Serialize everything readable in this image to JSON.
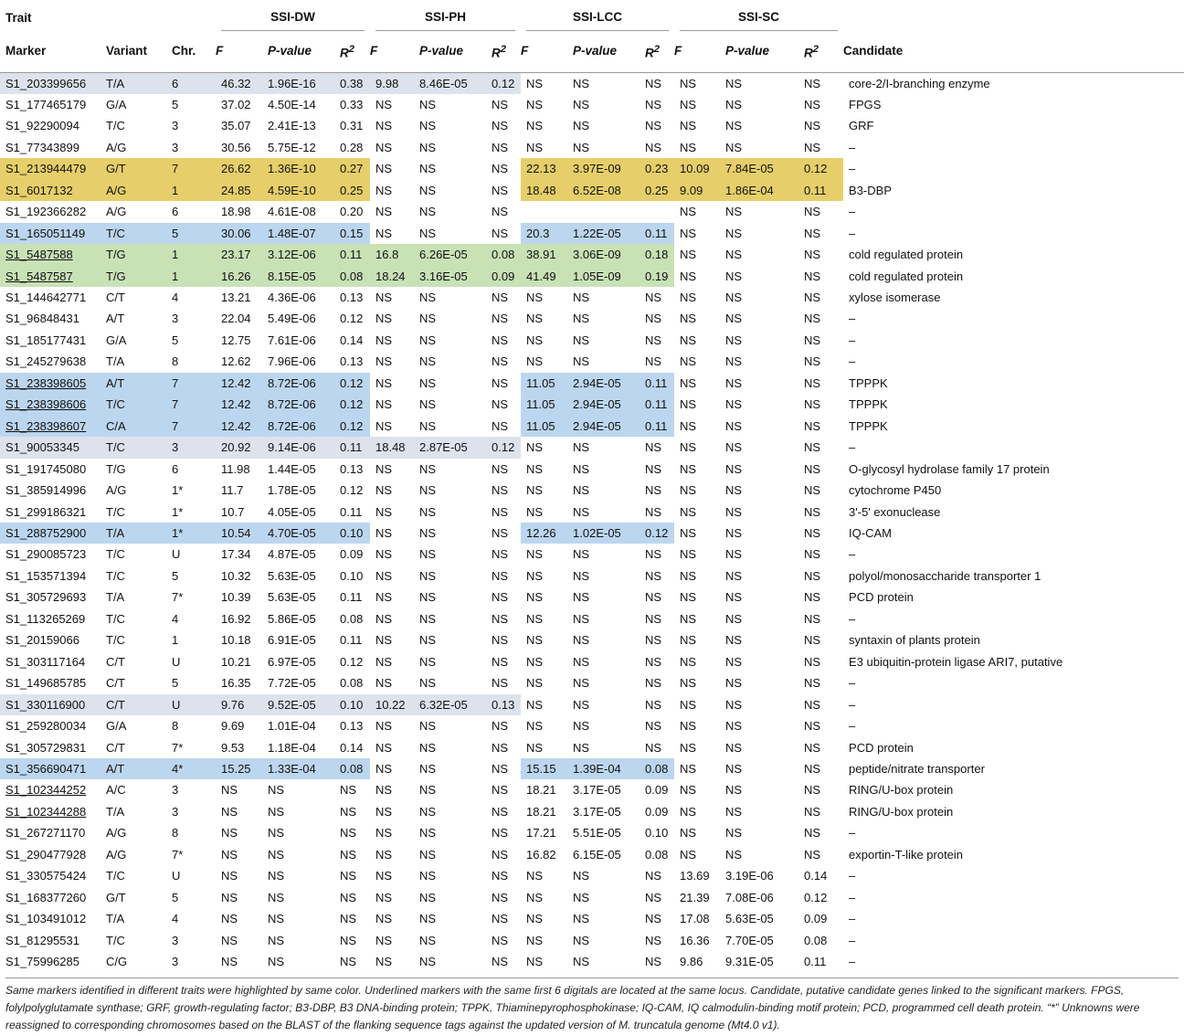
{
  "header": {
    "trait": "Trait",
    "groups": [
      "SSI-DW",
      "SSI-PH",
      "SSI-LCC",
      "SSI-SC"
    ],
    "marker": "Marker",
    "variant": "Variant",
    "chr": "Chr.",
    "f": "F",
    "p": "P-value",
    "r_base": "R",
    "r_sup": "2",
    "candidate": "Candidate"
  },
  "colors": {
    "gray": "#dde3ec",
    "yellow": "#e6cf6a",
    "blue": "#bcd6ef",
    "green": "#c8e2b6"
  },
  "rows": [
    {
      "m": "S1_203399656",
      "v": "T/A",
      "c": "6",
      "dw": [
        "46.32",
        "1.96E-16",
        "0.38"
      ],
      "ph": [
        "9.98",
        "8.46E-05",
        "0.12"
      ],
      "lcc": [
        "NS",
        "NS",
        "NS"
      ],
      "sc": [
        "NS",
        "NS",
        "NS"
      ],
      "cand": "core-2/I-branching enzyme",
      "hl": "gray",
      "hg": [
        "dw",
        "ph"
      ]
    },
    {
      "m": "S1_177465179",
      "v": "G/A",
      "c": "5",
      "dw": [
        "37.02",
        "4.50E-14",
        "0.33"
      ],
      "ph": [
        "NS",
        "NS",
        "NS"
      ],
      "lcc": [
        "NS",
        "NS",
        "NS"
      ],
      "sc": [
        "NS",
        "NS",
        "NS"
      ],
      "cand": "FPGS"
    },
    {
      "m": "S1_92290094",
      "v": "T/C",
      "c": "3",
      "dw": [
        "35.07",
        "2.41E-13",
        "0.31"
      ],
      "ph": [
        "NS",
        "NS",
        "NS"
      ],
      "lcc": [
        "NS",
        "NS",
        "NS"
      ],
      "sc": [
        "NS",
        "NS",
        "NS"
      ],
      "cand": "GRF"
    },
    {
      "m": "S1_77343899",
      "v": "A/G",
      "c": "3",
      "dw": [
        "30.56",
        "5.75E-12",
        "0.28"
      ],
      "ph": [
        "NS",
        "NS",
        "NS"
      ],
      "lcc": [
        "NS",
        "NS",
        "NS"
      ],
      "sc": [
        "NS",
        "NS",
        "NS"
      ],
      "cand": "–"
    },
    {
      "m": "S1_213944479",
      "v": "G/T",
      "c": "7",
      "dw": [
        "26.62",
        "1.36E-10",
        "0.27"
      ],
      "ph": [
        "NS",
        "NS",
        "NS"
      ],
      "lcc": [
        "22.13",
        "3.97E-09",
        "0.23"
      ],
      "sc": [
        "10.09",
        "7.84E-05",
        "0.12"
      ],
      "cand": "–",
      "hl": "yellow",
      "hg": [
        "dw",
        "lcc",
        "sc"
      ]
    },
    {
      "m": "S1_6017132",
      "v": "A/G",
      "c": "1",
      "dw": [
        "24.85",
        "4.59E-10",
        "0.25"
      ],
      "ph": [
        "NS",
        "NS",
        "NS"
      ],
      "lcc": [
        "18.48",
        "6.52E-08",
        "0.25"
      ],
      "sc": [
        "9.09",
        "1.86E-04",
        "0.11"
      ],
      "cand": "B3-DBP",
      "hl": "yellow",
      "hg": [
        "dw",
        "lcc",
        "sc"
      ]
    },
    {
      "m": "S1_192366282",
      "v": "A/G",
      "c": "6",
      "dw": [
        "18.98",
        "4.61E-08",
        "0.20"
      ],
      "ph": [
        "NS",
        "NS",
        "NS"
      ],
      "lcc": [
        "",
        "",
        ""
      ],
      "sc": [
        "NS",
        "NS",
        "NS"
      ],
      "cand": "–"
    },
    {
      "m": "S1_165051149",
      "v": "T/C",
      "c": "5",
      "dw": [
        "30.06",
        "1.48E-07",
        "0.15"
      ],
      "ph": [
        "NS",
        "NS",
        "NS"
      ],
      "lcc": [
        "20.3",
        "1.22E-05",
        "0.11"
      ],
      "sc": [
        "NS",
        "NS",
        "NS"
      ],
      "cand": "–",
      "hl": "blue",
      "hg": [
        "dw",
        "lcc"
      ]
    },
    {
      "m": "S1_5487588",
      "v": "T/G",
      "c": "1",
      "dw": [
        "23.17",
        "3.12E-06",
        "0.11"
      ],
      "ph": [
        "16.8",
        "6.26E-05",
        "0.08"
      ],
      "lcc": [
        "38.91",
        "3.06E-09",
        "0.18"
      ],
      "sc": [
        "NS",
        "NS",
        "NS"
      ],
      "cand": "cold regulated protein",
      "hl": "green",
      "hg": [
        "dw",
        "ph",
        "lcc"
      ],
      "u": true
    },
    {
      "m": "S1_5487587",
      "v": "T/G",
      "c": "1",
      "dw": [
        "16.26",
        "8.15E-05",
        "0.08"
      ],
      "ph": [
        "18.24",
        "3.16E-05",
        "0.09"
      ],
      "lcc": [
        "41.49",
        "1.05E-09",
        "0.19"
      ],
      "sc": [
        "NS",
        "NS",
        "NS"
      ],
      "cand": "cold regulated protein",
      "hl": "green",
      "hg": [
        "dw",
        "ph",
        "lcc"
      ],
      "u": true
    },
    {
      "m": "S1_144642771",
      "v": "C/T",
      "c": "4",
      "dw": [
        "13.21",
        "4.36E-06",
        "0.13"
      ],
      "ph": [
        "NS",
        "NS",
        "NS"
      ],
      "lcc": [
        "NS",
        "NS",
        "NS"
      ],
      "sc": [
        "NS",
        "NS",
        "NS"
      ],
      "cand": "xylose isomerase"
    },
    {
      "m": "S1_96848431",
      "v": "A/T",
      "c": "3",
      "dw": [
        "22.04",
        "5.49E-06",
        "0.12"
      ],
      "ph": [
        "NS",
        "NS",
        "NS"
      ],
      "lcc": [
        "NS",
        "NS",
        "NS"
      ],
      "sc": [
        "NS",
        "NS",
        "NS"
      ],
      "cand": "–"
    },
    {
      "m": "S1_185177431",
      "v": "G/A",
      "c": "5",
      "dw": [
        "12.75",
        "7.61E-06",
        "0.14"
      ],
      "ph": [
        "NS",
        "NS",
        "NS"
      ],
      "lcc": [
        "NS",
        "NS",
        "NS"
      ],
      "sc": [
        "NS",
        "NS",
        "NS"
      ],
      "cand": "–"
    },
    {
      "m": "S1_245279638",
      "v": "T/A",
      "c": "8",
      "dw": [
        "12.62",
        "7.96E-06",
        "0.13"
      ],
      "ph": [
        "NS",
        "NS",
        "NS"
      ],
      "lcc": [
        "NS",
        "NS",
        "NS"
      ],
      "sc": [
        "NS",
        "NS",
        "NS"
      ],
      "cand": "–"
    },
    {
      "m": "S1_238398605",
      "v": "A/T",
      "c": "7",
      "dw": [
        "12.42",
        "8.72E-06",
        "0.12"
      ],
      "ph": [
        "NS",
        "NS",
        "NS"
      ],
      "lcc": [
        "11.05",
        "2.94E-05",
        "0.11"
      ],
      "sc": [
        "NS",
        "NS",
        "NS"
      ],
      "cand": "TPPPK",
      "hl": "blue",
      "hg": [
        "dw",
        "lcc"
      ],
      "u": true
    },
    {
      "m": "S1_238398606",
      "v": "T/C",
      "c": "7",
      "dw": [
        "12.42",
        "8.72E-06",
        "0.12"
      ],
      "ph": [
        "NS",
        "NS",
        "NS"
      ],
      "lcc": [
        "11.05",
        "2.94E-05",
        "0.11"
      ],
      "sc": [
        "NS",
        "NS",
        "NS"
      ],
      "cand": "TPPPK",
      "hl": "blue",
      "hg": [
        "dw",
        "lcc"
      ],
      "u": true
    },
    {
      "m": "S1_238398607",
      "v": "C/A",
      "c": "7",
      "dw": [
        "12.42",
        "8.72E-06",
        "0.12"
      ],
      "ph": [
        "NS",
        "NS",
        "NS"
      ],
      "lcc": [
        "11.05",
        "2.94E-05",
        "0.11"
      ],
      "sc": [
        "NS",
        "NS",
        "NS"
      ],
      "cand": "TPPPK",
      "hl": "blue",
      "hg": [
        "dw",
        "lcc"
      ],
      "u": true
    },
    {
      "m": "S1_90053345",
      "v": "T/C",
      "c": "3",
      "dw": [
        "20.92",
        "9.14E-06",
        "0.11"
      ],
      "ph": [
        "18.48",
        "2.87E-05",
        "0.12"
      ],
      "lcc": [
        "NS",
        "NS",
        "NS"
      ],
      "sc": [
        "NS",
        "NS",
        "NS"
      ],
      "cand": "–",
      "hl": "gray",
      "hg": [
        "dw",
        "ph"
      ]
    },
    {
      "m": "S1_191745080",
      "v": "T/G",
      "c": "6",
      "dw": [
        "11.98",
        "1.44E-05",
        "0.13"
      ],
      "ph": [
        "NS",
        "NS",
        "NS"
      ],
      "lcc": [
        "NS",
        "NS",
        "NS"
      ],
      "sc": [
        "NS",
        "NS",
        "NS"
      ],
      "cand": "O-glycosyl hydrolase family 17 protein"
    },
    {
      "m": "S1_385914996",
      "v": "A/G",
      "c": "1*",
      "dw": [
        "11.7",
        "1.78E-05",
        "0.12"
      ],
      "ph": [
        "NS",
        "NS",
        "NS"
      ],
      "lcc": [
        "NS",
        "NS",
        "NS"
      ],
      "sc": [
        "NS",
        "NS",
        "NS"
      ],
      "cand": "cytochrome P450"
    },
    {
      "m": "S1_299186321",
      "v": "T/C",
      "c": "1*",
      "dw": [
        "10.7",
        "4.05E-05",
        "0.11"
      ],
      "ph": [
        "NS",
        "NS",
        "NS"
      ],
      "lcc": [
        "NS",
        "NS",
        "NS"
      ],
      "sc": [
        "NS",
        "NS",
        "NS"
      ],
      "cand": "3'-5' exonuclease"
    },
    {
      "m": "S1_288752900",
      "v": "T/A",
      "c": "1*",
      "dw": [
        "10.54",
        "4.70E-05",
        "0.10"
      ],
      "ph": [
        "NS",
        "NS",
        "NS"
      ],
      "lcc": [
        "12.26",
        "1.02E-05",
        "0.12"
      ],
      "sc": [
        "NS",
        "NS",
        "NS"
      ],
      "cand": "IQ-CAM",
      "hl": "blue",
      "hg": [
        "dw",
        "lcc"
      ]
    },
    {
      "m": "S1_290085723",
      "v": "T/C",
      "c": "U",
      "dw": [
        "17.34",
        "4.87E-05",
        "0.09"
      ],
      "ph": [
        "NS",
        "NS",
        "NS"
      ],
      "lcc": [
        "NS",
        "NS",
        "NS"
      ],
      "sc": [
        "NS",
        "NS",
        "NS"
      ],
      "cand": "–"
    },
    {
      "m": "S1_153571394",
      "v": "T/C",
      "c": "5",
      "dw": [
        "10.32",
        "5.63E-05",
        "0.10"
      ],
      "ph": [
        "NS",
        "NS",
        "NS"
      ],
      "lcc": [
        "NS",
        "NS",
        "NS"
      ],
      "sc": [
        "NS",
        "NS",
        "NS"
      ],
      "cand": "polyol/monosaccharide transporter 1"
    },
    {
      "m": "S1_305729693",
      "v": "T/A",
      "c": "7*",
      "dw": [
        "10.39",
        "5.63E-05",
        "0.11"
      ],
      "ph": [
        "NS",
        "NS",
        "NS"
      ],
      "lcc": [
        "NS",
        "NS",
        "NS"
      ],
      "sc": [
        "NS",
        "NS",
        "NS"
      ],
      "cand": "PCD protein"
    },
    {
      "m": "S1_113265269",
      "v": "T/C",
      "c": "4",
      "dw": [
        "16.92",
        "5.86E-05",
        "0.08"
      ],
      "ph": [
        "NS",
        "NS",
        "NS"
      ],
      "lcc": [
        "NS",
        "NS",
        "NS"
      ],
      "sc": [
        "NS",
        "NS",
        "NS"
      ],
      "cand": "–"
    },
    {
      "m": "S1_20159066",
      "v": "T/C",
      "c": "1",
      "dw": [
        "10.18",
        "6.91E-05",
        "0.11"
      ],
      "ph": [
        "NS",
        "NS",
        "NS"
      ],
      "lcc": [
        "NS",
        "NS",
        "NS"
      ],
      "sc": [
        "NS",
        "NS",
        "NS"
      ],
      "cand": "syntaxin of plants protein"
    },
    {
      "m": "S1_303117164",
      "v": "C/T",
      "c": "U",
      "dw": [
        "10.21",
        "6.97E-05",
        "0.12"
      ],
      "ph": [
        "NS",
        "NS",
        "NS"
      ],
      "lcc": [
        "NS",
        "NS",
        "NS"
      ],
      "sc": [
        "NS",
        "NS",
        "NS"
      ],
      "cand": "E3 ubiquitin-protein ligase ARI7, putative"
    },
    {
      "m": "S1_149685785",
      "v": "C/T",
      "c": "5",
      "dw": [
        "16.35",
        "7.72E-05",
        "0.08"
      ],
      "ph": [
        "NS",
        "NS",
        "NS"
      ],
      "lcc": [
        "NS",
        "NS",
        "NS"
      ],
      "sc": [
        "NS",
        "NS",
        "NS"
      ],
      "cand": "–"
    },
    {
      "m": "S1_330116900",
      "v": "C/T",
      "c": "U",
      "dw": [
        "9.76",
        "9.52E-05",
        "0.10"
      ],
      "ph": [
        "10.22",
        "6.32E-05",
        "0.13"
      ],
      "lcc": [
        "NS",
        "NS",
        "NS"
      ],
      "sc": [
        "NS",
        "NS",
        "NS"
      ],
      "cand": "–",
      "hl": "gray",
      "hg": [
        "dw",
        "ph"
      ]
    },
    {
      "m": "S1_259280034",
      "v": "G/A",
      "c": "8",
      "dw": [
        "9.69",
        "1.01E-04",
        "0.13"
      ],
      "ph": [
        "NS",
        "NS",
        "NS"
      ],
      "lcc": [
        "NS",
        "NS",
        "NS"
      ],
      "sc": [
        "NS",
        "NS",
        "NS"
      ],
      "cand": "–"
    },
    {
      "m": "S1_305729831",
      "v": "C/T",
      "c": "7*",
      "dw": [
        "9.53",
        "1.18E-04",
        "0.14"
      ],
      "ph": [
        "NS",
        "NS",
        "NS"
      ],
      "lcc": [
        "NS",
        "NS",
        "NS"
      ],
      "sc": [
        "NS",
        "NS",
        "NS"
      ],
      "cand": "PCD protein"
    },
    {
      "m": "S1_356690471",
      "v": "A/T",
      "c": "4*",
      "dw": [
        "15.25",
        "1.33E-04",
        "0.08"
      ],
      "ph": [
        "NS",
        "NS",
        "NS"
      ],
      "lcc": [
        "15.15",
        "1.39E-04",
        "0.08"
      ],
      "sc": [
        "NS",
        "NS",
        "NS"
      ],
      "cand": "peptide/nitrate transporter",
      "hl": "blue",
      "hg": [
        "dw",
        "lcc"
      ]
    },
    {
      "m": "S1_102344252",
      "v": "A/C",
      "c": "3",
      "dw": [
        "NS",
        "NS",
        "NS"
      ],
      "ph": [
        "NS",
        "NS",
        "NS"
      ],
      "lcc": [
        "18.21",
        "3.17E-05",
        "0.09"
      ],
      "sc": [
        "NS",
        "NS",
        "NS"
      ],
      "cand": "RING/U-box protein",
      "u": true
    },
    {
      "m": "S1_102344288",
      "v": "T/A",
      "c": "3",
      "dw": [
        "NS",
        "NS",
        "NS"
      ],
      "ph": [
        "NS",
        "NS",
        "NS"
      ],
      "lcc": [
        "18.21",
        "3.17E-05",
        "0.09"
      ],
      "sc": [
        "NS",
        "NS",
        "NS"
      ],
      "cand": "RING/U-box protein",
      "u": true
    },
    {
      "m": "S1_267271170",
      "v": "A/G",
      "c": "8",
      "dw": [
        "NS",
        "NS",
        "NS"
      ],
      "ph": [
        "NS",
        "NS",
        "NS"
      ],
      "lcc": [
        "17.21",
        "5.51E-05",
        "0.10"
      ],
      "sc": [
        "NS",
        "NS",
        "NS"
      ],
      "cand": "–"
    },
    {
      "m": "S1_290477928",
      "v": "A/G",
      "c": "7*",
      "dw": [
        "NS",
        "NS",
        "NS"
      ],
      "ph": [
        "NS",
        "NS",
        "NS"
      ],
      "lcc": [
        "16.82",
        "6.15E-05",
        "0.08"
      ],
      "sc": [
        "NS",
        "NS",
        "NS"
      ],
      "cand": "exportin-T-like protein"
    },
    {
      "m": "S1_330575424",
      "v": "T/C",
      "c": "U",
      "dw": [
        "NS",
        "NS",
        "NS"
      ],
      "ph": [
        "NS",
        "NS",
        "NS"
      ],
      "lcc": [
        "NS",
        "NS",
        "NS"
      ],
      "sc": [
        "13.69",
        "3.19E-06",
        "0.14"
      ],
      "cand": "–"
    },
    {
      "m": "S1_168377260",
      "v": "G/T",
      "c": "5",
      "dw": [
        "NS",
        "NS",
        "NS"
      ],
      "ph": [
        "NS",
        "NS",
        "NS"
      ],
      "lcc": [
        "NS",
        "NS",
        "NS"
      ],
      "sc": [
        "21.39",
        "7.08E-06",
        "0.12"
      ],
      "cand": "–"
    },
    {
      "m": "S1_103491012",
      "v": "T/A",
      "c": "4",
      "dw": [
        "NS",
        "NS",
        "NS"
      ],
      "ph": [
        "NS",
        "NS",
        "NS"
      ],
      "lcc": [
        "NS",
        "NS",
        "NS"
      ],
      "sc": [
        "17.08",
        "5.63E-05",
        "0.09"
      ],
      "cand": "–"
    },
    {
      "m": "S1_81295531",
      "v": "T/C",
      "c": "3",
      "dw": [
        "NS",
        "NS",
        "NS"
      ],
      "ph": [
        "NS",
        "NS",
        "NS"
      ],
      "lcc": [
        "NS",
        "NS",
        "NS"
      ],
      "sc": [
        "16.36",
        "7.70E-05",
        "0.08"
      ],
      "cand": "–"
    },
    {
      "m": "S1_75996285",
      "v": "C/G",
      "c": "3",
      "dw": [
        "NS",
        "NS",
        "NS"
      ],
      "ph": [
        "NS",
        "NS",
        "NS"
      ],
      "lcc": [
        "NS",
        "NS",
        "NS"
      ],
      "sc": [
        "9.86",
        "9.31E-05",
        "0.11"
      ],
      "cand": "–"
    }
  ],
  "footnote": "Same markers identified in different traits were highlighted by same color. Underlined markers with the same first 6 digitals are located at the same locus. Candidate, putative candidate genes linked to the significant markers. FPGS, folylpolyglutamate synthase; GRF, growth-regulating factor; B3-DBP, B3 DNA-binding protein; TPPK, Thiaminepyrophosphokinase; IQ-CAM, IQ calmodulin-binding motif protein; PCD, programmed cell death protein. “*” Unknowns were reassigned to corresponding chromosomes based on the BLAST of the flanking sequence tags against the updated version of M. truncatula genome (Mt4.0 v1)."
}
